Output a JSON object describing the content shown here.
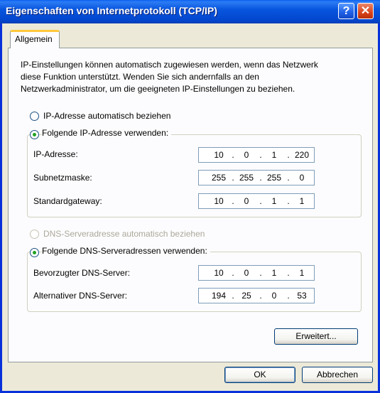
{
  "window": {
    "title": "Eigenschaften von Internetprotokoll (TCP/IP)",
    "help_label": "?",
    "close_label": "✕"
  },
  "tab": {
    "label": "Allgemein"
  },
  "intro_text": "IP-Einstellungen können automatisch zugewiesen werden, wenn das Netzwerk diese Funktion unterstützt. Wenden Sie sich andernfalls an den Netzwerkadministrator, um die geeigneten IP-Einstellungen zu beziehen.",
  "ip": {
    "auto_label": "IP-Adresse automatisch beziehen",
    "manual_label": "Folgende IP-Adresse verwenden:",
    "selected": "manual",
    "fields": [
      {
        "label": "IP-Adresse:",
        "octets": [
          "10",
          "0",
          "1",
          "220"
        ]
      },
      {
        "label": "Subnetzmaske:",
        "octets": [
          "255",
          "255",
          "255",
          "0"
        ]
      },
      {
        "label": "Standardgateway:",
        "octets": [
          "10",
          "0",
          "1",
          "1"
        ]
      }
    ]
  },
  "dns": {
    "auto_label": "DNS-Serveradresse automatisch beziehen",
    "manual_label": "Folgende DNS-Serveradressen verwenden:",
    "selected": "manual",
    "fields": [
      {
        "label": "Bevorzugter DNS-Server:",
        "octets": [
          "10",
          "0",
          "1",
          "1"
        ]
      },
      {
        "label": "Alternativer DNS-Server:",
        "octets": [
          "194",
          "25",
          "0",
          "53"
        ]
      }
    ]
  },
  "buttons": {
    "advanced": "Erweitert...",
    "ok": "OK",
    "cancel": "Abbrechen"
  },
  "colors": {
    "title_bar": "#0a5ff0",
    "dialog_bg": "#ece9d8",
    "radio_dot": "#21a121",
    "tab_accent": "#ffc83c"
  }
}
